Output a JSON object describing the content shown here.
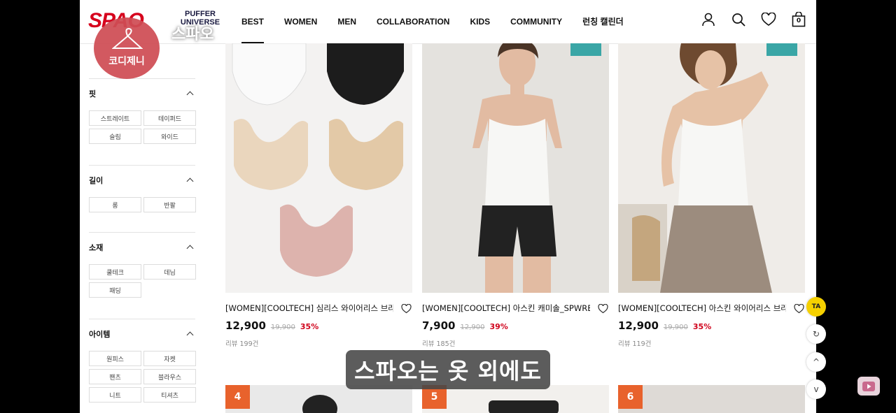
{
  "header": {
    "logo": "SPAO",
    "sub_brand_line1": "PUFFER",
    "sub_brand_line2": "UNIVERSE",
    "nav": [
      "BEST",
      "WOMEN",
      "MEN",
      "COLLABORATION",
      "KIDS",
      "COMMUNITY",
      "런칭 캘린더"
    ],
    "active_nav": "BEST",
    "cart_count": "0"
  },
  "watermark": {
    "badge_text": "코디제니",
    "overlay_text": "스파오"
  },
  "sidebar": {
    "sections": [
      {
        "title": "핏",
        "options": [
          "스트레이트",
          "테이퍼드",
          "슬림",
          "와이드"
        ]
      },
      {
        "title": "길이",
        "options": [
          "롱",
          "반팔"
        ]
      },
      {
        "title": "소재",
        "options": [
          "쿨테크",
          "데님",
          "패딩"
        ]
      },
      {
        "title": "아이템",
        "options": [
          "원피스",
          "자켓",
          "팬츠",
          "블라우스",
          "니트",
          "티셔츠"
        ]
      }
    ]
  },
  "products": [
    {
      "name": "[WOMEN][COOLTECH] 심리스 와이어리스 브라",
      "price": "12,900",
      "original_price": "19,900",
      "discount": "35%",
      "review": "리뷰 199건"
    },
    {
      "name": "[WOMEN][COOLTECH] 아스킨 캐미솔_SPWRE",
      "price": "7,900",
      "original_price": "12,900",
      "discount": "39%",
      "review": "리뷰 185건"
    },
    {
      "name": "[WOMEN][COOLTECH] 아스킨 와이어리스 브라",
      "price": "12,900",
      "original_price": "19,900",
      "discount": "35%",
      "review": "리뷰 119건"
    }
  ],
  "next_ranks": [
    "4",
    "5",
    "6"
  ],
  "subtitle": "스파오는 옷 외에도",
  "colors": {
    "brand": "#d6001c",
    "discount": "#d0021b",
    "rank_badge": "#e8622c"
  }
}
